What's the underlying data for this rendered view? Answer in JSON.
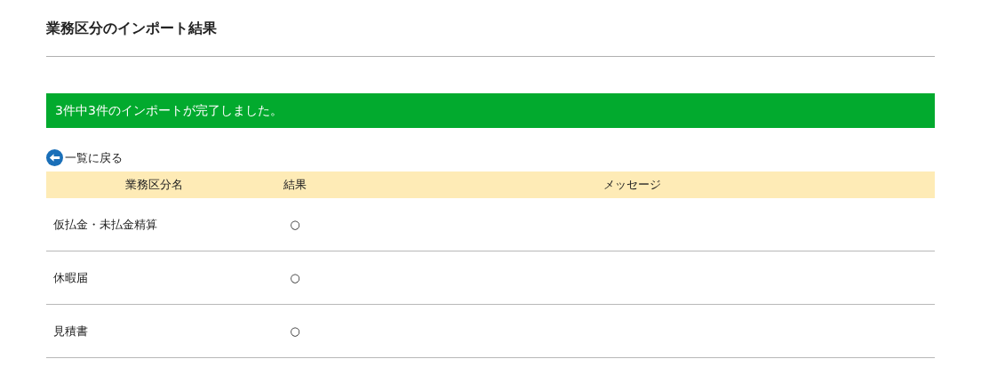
{
  "title": "業務区分のインポート結果",
  "banner": "3件中3件のインポートが完了しました。",
  "back_link": "一覧に戻る",
  "table": {
    "columns": [
      "業務区分名",
      "結果",
      "メッセージ"
    ],
    "rows": [
      {
        "name": "仮払金・未払金精算",
        "result": "○"
      },
      {
        "name": "休暇届",
        "result": "○"
      },
      {
        "name": "見積書",
        "result": "○"
      }
    ]
  }
}
